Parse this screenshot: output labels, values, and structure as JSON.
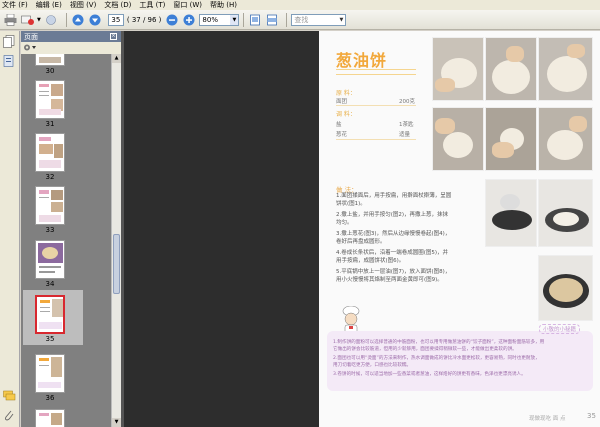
{
  "menu": [
    "文件 (F)",
    "编辑 (E)",
    "视图 (V)",
    "文档 (D)",
    "工具 (T)",
    "窗口 (W)",
    "帮助 (H)"
  ],
  "toolbar": {
    "current_page": "35",
    "page_count": "( 37 / 96 )",
    "zoom": "80%",
    "search_placeholder": "查找"
  },
  "pages_panel": {
    "title": "页面",
    "thumbnails": [
      {
        "label": "30"
      },
      {
        "label": "31"
      },
      {
        "label": "32"
      },
      {
        "label": "33"
      },
      {
        "label": "34"
      },
      {
        "label": "35",
        "selected": true
      },
      {
        "label": "36"
      }
    ]
  },
  "document": {
    "title": "葱油饼",
    "ingredients_label": "原 料：",
    "ingredients": [
      {
        "name": "面团",
        "amount": "200克"
      }
    ],
    "seasoning_label": "调 料：",
    "seasonings": [
      {
        "name": "盐",
        "amount": "1茶匙"
      },
      {
        "name": "葱花",
        "amount": "适量"
      }
    ],
    "steps_label": "做 法：",
    "steps": [
      "1.面团揉面后，用手按扁，用擀面杖擀薄，呈圆",
      "  饼状(图1)。",
      "2.撒上盐，并用手按匀(图2)，再撒上葱，抹抹",
      "  均匀。",
      "3.撒上葱花(图3)，然后从边缘慢慢卷起(图4)，",
      "  卷好后再盘成圆形。",
      "4.卷成长条状后，沿着一端卷成圆圈(图5)，并",
      "  用手按扁，成圆饼状(图6)。",
      "5.平底锅中放上一层油(图7)，放入面饼(图8)，",
      "  用小火慢慢将其烙制至两面金黄即可(图9)。"
    ],
    "tip_title": "小敬的小秘籍",
    "tips": [
      "1.制作饼的面粉可以选择普通的中筋面粉，也可以用专用做葱油饼的“饺子面粉”，这种面粉面筋较多，用",
      "  它做出的饼会比较筋道，但用的少就够用，面团要揉得稍微软一些，才能做出更柔软的饼。",
      "2.面团也可以用“烫面”的方法来制作，热水调面做成的饼比冷水面更松软，更容易熟，同时也更耐放，",
      "  用刀切着吃更方便，口感也比较软糯。",
      "3.卷饼的时候，可以适当地加一些香菜或者葱油，这样烙好的饼更有香味，色泽也更漂亮诱人。"
    ],
    "footer_text": "现做现吃 面 点",
    "page_number": "35"
  },
  "colors": {
    "title": "#f2a83b",
    "tip_text": "#9b6aa8",
    "panel_header": "#6b7b95"
  }
}
